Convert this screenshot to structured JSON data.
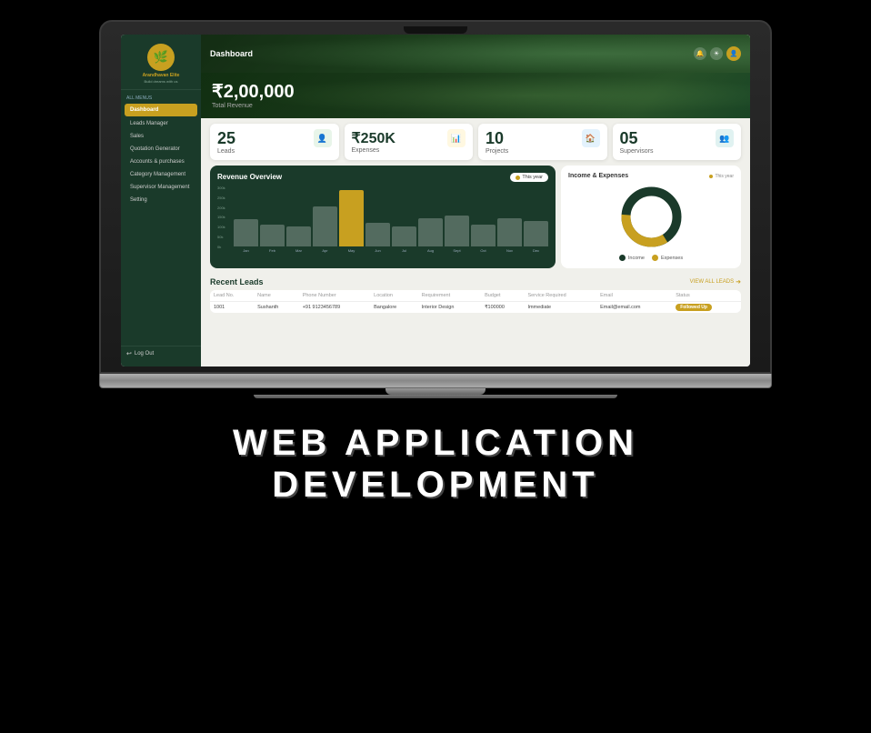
{
  "app": {
    "name": "Arandhavan Elite",
    "subtitle": "Build dreams with us",
    "logo_char": "🌿"
  },
  "header": {
    "title": "Dashboard",
    "icons": [
      "🔔",
      "☀",
      "👤"
    ]
  },
  "revenue": {
    "amount": "₹2,00,000",
    "label": "Total Revenue"
  },
  "stats": [
    {
      "number": "25",
      "label": "Leads",
      "icon": "👤",
      "icon_class": "green"
    },
    {
      "number": "₹250K",
      "label": "Expenses",
      "icon": "📊",
      "icon_class": "yellow"
    },
    {
      "number": "10",
      "label": "Projects",
      "icon": "🏠",
      "icon_class": "blue"
    },
    {
      "number": "05",
      "label": "Supervisors",
      "icon": "👤",
      "icon_class": "teal"
    }
  ],
  "revenue_chart": {
    "title": "Revenue Overview",
    "badge": "This year",
    "months": [
      "Jan",
      "Feb",
      "Mar",
      "Apr",
      "May",
      "Jun",
      "Jul",
      "Aug",
      "Sept",
      "Oct",
      "Nov",
      "Dec"
    ],
    "values": [
      35,
      30,
      28,
      55,
      75,
      32,
      28,
      38,
      42,
      30,
      38,
      35
    ],
    "highlight_month": 4
  },
  "donut_chart": {
    "title": "Income & Expenses",
    "badge": "This year",
    "income_pct": 65,
    "expense_pct": 35,
    "income_color": "#1a3a2a",
    "expense_color": "#c8a020",
    "legend": [
      {
        "label": "Income",
        "color": "#1a3a2a"
      },
      {
        "label": "Expenses",
        "color": "#c8a020"
      }
    ]
  },
  "sidebar": {
    "section_label": "All Menus",
    "items": [
      {
        "label": "Dashboard",
        "active": true
      },
      {
        "label": "Leads Manager",
        "active": false
      },
      {
        "label": "Sales",
        "active": false
      },
      {
        "label": "Quotation Generator",
        "active": false
      },
      {
        "label": "Accounts & purchases",
        "active": false
      },
      {
        "label": "Category Management",
        "active": false
      },
      {
        "label": "Supervisor Management",
        "active": false
      },
      {
        "label": "Setting",
        "active": false
      }
    ],
    "logout": "Log Out"
  },
  "recent_leads": {
    "title": "Recent Leads",
    "view_all": "VIEW ALL LEADS",
    "columns": [
      "Lead No.",
      "Name",
      "Phone Number",
      "Location",
      "Requirement",
      "Budget",
      "Service Required",
      "Email",
      "Status"
    ],
    "rows": [
      {
        "lead_no": "1001",
        "name": "Sushanth",
        "phone": "+91 9123456789",
        "location": "Bangalore",
        "requirement": "Interior Design",
        "budget": "₹100000",
        "service": "Immediate",
        "email": "Email@email.com",
        "status": "Followed Up",
        "status_class": "followed-up"
      }
    ]
  },
  "bottom_text": {
    "line1": "WEB APPLICATION",
    "line2": "DEVELOPMENT"
  }
}
